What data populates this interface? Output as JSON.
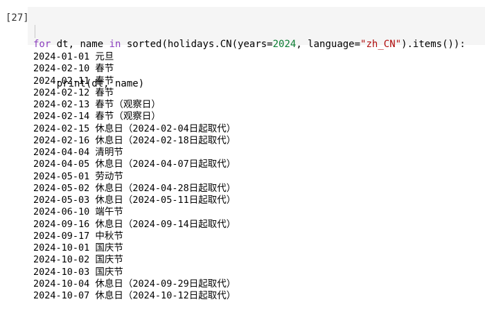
{
  "cell": {
    "prompt": "[27]",
    "code": {
      "line1": [
        {
          "t": "for",
          "k": "kw"
        },
        {
          "t": " dt, name ",
          "k": ""
        },
        {
          "t": "in",
          "k": "kw"
        },
        {
          "t": " sorted(holidays.CN(years=",
          "k": ""
        },
        {
          "t": "2024",
          "k": "num"
        },
        {
          "t": ", language=",
          "k": ""
        },
        {
          "t": "\"zh_CN\"",
          "k": "str"
        },
        {
          "t": ").items()):",
          "k": ""
        }
      ],
      "line2": "    print(dt, name)"
    }
  },
  "output": [
    {
      "date": "2024-01-01",
      "name": "元旦"
    },
    {
      "date": "2024-02-10",
      "name": "春节"
    },
    {
      "date": "2024-02-11",
      "name": "春节"
    },
    {
      "date": "2024-02-12",
      "name": "春节"
    },
    {
      "date": "2024-02-13",
      "name": "春节（观察日）"
    },
    {
      "date": "2024-02-14",
      "name": "春节（观察日）"
    },
    {
      "date": "2024-02-15",
      "name": "休息日（2024-02-04日起取代）"
    },
    {
      "date": "2024-02-16",
      "name": "休息日（2024-02-18日起取代）"
    },
    {
      "date": "2024-04-04",
      "name": "清明节"
    },
    {
      "date": "2024-04-05",
      "name": "休息日（2024-04-07日起取代）"
    },
    {
      "date": "2024-05-01",
      "name": "劳动节"
    },
    {
      "date": "2024-05-02",
      "name": "休息日（2024-04-28日起取代）"
    },
    {
      "date": "2024-05-03",
      "name": "休息日（2024-05-11日起取代）"
    },
    {
      "date": "2024-06-10",
      "name": "端午节"
    },
    {
      "date": "2024-09-16",
      "name": "休息日（2024-09-14日起取代）"
    },
    {
      "date": "2024-09-17",
      "name": "中秋节"
    },
    {
      "date": "2024-10-01",
      "name": "国庆节"
    },
    {
      "date": "2024-10-02",
      "name": "国庆节"
    },
    {
      "date": "2024-10-03",
      "name": "国庆节"
    },
    {
      "date": "2024-10-04",
      "name": "休息日（2024-09-29日起取代）"
    },
    {
      "date": "2024-10-07",
      "name": "休息日（2024-10-12日起取代）"
    }
  ],
  "colors": {
    "keyword": "#8b3fbf",
    "number": "#0b7d33",
    "string": "#b00a0a",
    "input_bg": "#f5f5f5"
  }
}
